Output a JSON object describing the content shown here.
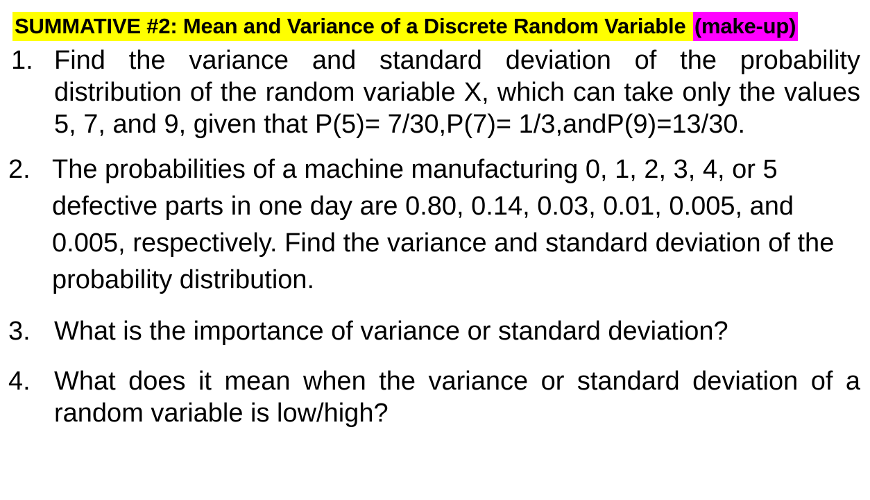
{
  "title": {
    "highlight_yellow_color": "#ffff00",
    "highlight_magenta_color": "#ff00ff",
    "main_text": "SUMMATIVE #2: Mean and Variance of a Discrete Random Variable ",
    "suffix_text": "(make-up)"
  },
  "items": [
    {
      "number": "1.",
      "text": "Find the variance and standard deviation of the probability distribution of the random variable X, which can take only the values 5, 7, and 9, given that P(5)= 7/30,P(7)= 1/3,andP(9)=13/30."
    },
    {
      "number": "2.",
      "text": "The probabilities of a machine manufacturing 0, 1, 2, 3, 4, or 5 defective parts in one day are 0.80, 0.14, 0.03, 0.01, 0.005, and 0.005, respectively. Find the variance and standard deviation of the probability distribution."
    },
    {
      "number": "3.",
      "text": "What is the importance of variance or standard deviation?"
    },
    {
      "number": "4.",
      "text": "What does it mean when the variance or standard deviation of a random variable is low/high?"
    }
  ]
}
